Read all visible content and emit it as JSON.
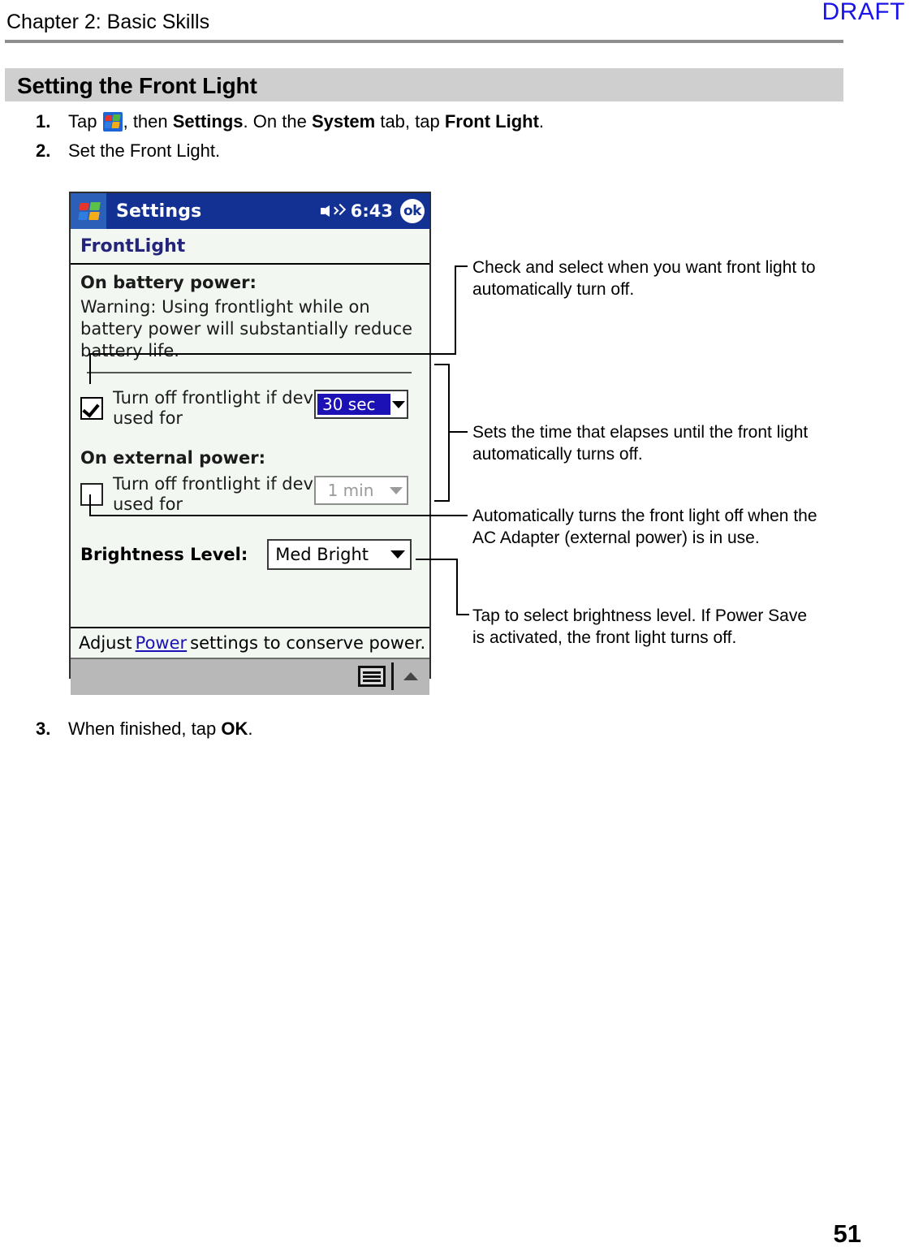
{
  "page": {
    "draft_watermark": "DRAFT",
    "chapter_title": "Chapter 2: Basic Skills",
    "section_title": "Setting the Front Light",
    "page_number": "51"
  },
  "steps": [
    {
      "number": "1.",
      "parts": [
        {
          "text": "Tap ",
          "bold": false
        },
        {
          "text": "[settings-icon]",
          "icon": "windows-start-icon"
        },
        {
          "text": ", then ",
          "bold": false
        },
        {
          "text": "Settings",
          "bold": true
        },
        {
          "text": ". On the ",
          "bold": false
        },
        {
          "text": "System",
          "bold": true
        },
        {
          "text": " tab, tap ",
          "bold": false
        },
        {
          "text": "Front Light",
          "bold": true
        },
        {
          "text": ".",
          "bold": false
        }
      ]
    },
    {
      "number": "2.",
      "text": "Set the Front Light."
    },
    {
      "number": "3.",
      "parts": [
        {
          "text": "When finished, tap ",
          "bold": false
        },
        {
          "text": "OK",
          "bold": true
        },
        {
          "text": ".",
          "bold": false
        }
      ]
    }
  ],
  "pda": {
    "titlebar": {
      "app_title": "Settings",
      "clock": "6:43",
      "ok_label": "ok",
      "speaker_icon": "speaker-icon",
      "start_icon": "windows-start-icon"
    },
    "subtitle": "FrontLight",
    "battery_section": {
      "heading": "On battery power:",
      "warning": "Warning: Using frontlight while on battery power will substantially reduce battery life.",
      "checkbox_checked": true,
      "checkbox_label": "Turn off frontlight if device is not used for",
      "timeout_value": "30 sec"
    },
    "external_section": {
      "heading": "On external power:",
      "checkbox_checked": false,
      "checkbox_label": "Turn off frontlight if device is not used for",
      "timeout_value": "1 min"
    },
    "brightness": {
      "label": "Brightness Level:",
      "value": "Med Bright"
    },
    "hint": {
      "prefix": "Adjust",
      "link": "Power",
      "suffix": "settings to conserve power."
    },
    "taskbar": {
      "keyboard_icon": "keyboard-icon",
      "up_arrow_icon": "chevron-up-icon"
    }
  },
  "callouts": [
    {
      "id": "callout-checkbox",
      "text": "Check and select when you want front light to automatically turn off."
    },
    {
      "id": "callout-timeout",
      "text": "Sets the time that elapses until the front light automatically turns off."
    },
    {
      "id": "callout-external",
      "text": "Automatically turns the front light off when the AC Adapter (external power) is in use."
    },
    {
      "id": "callout-brightness",
      "text": "Tap to select brightness level. If Power Save is activated, the front light turns off."
    }
  ]
}
